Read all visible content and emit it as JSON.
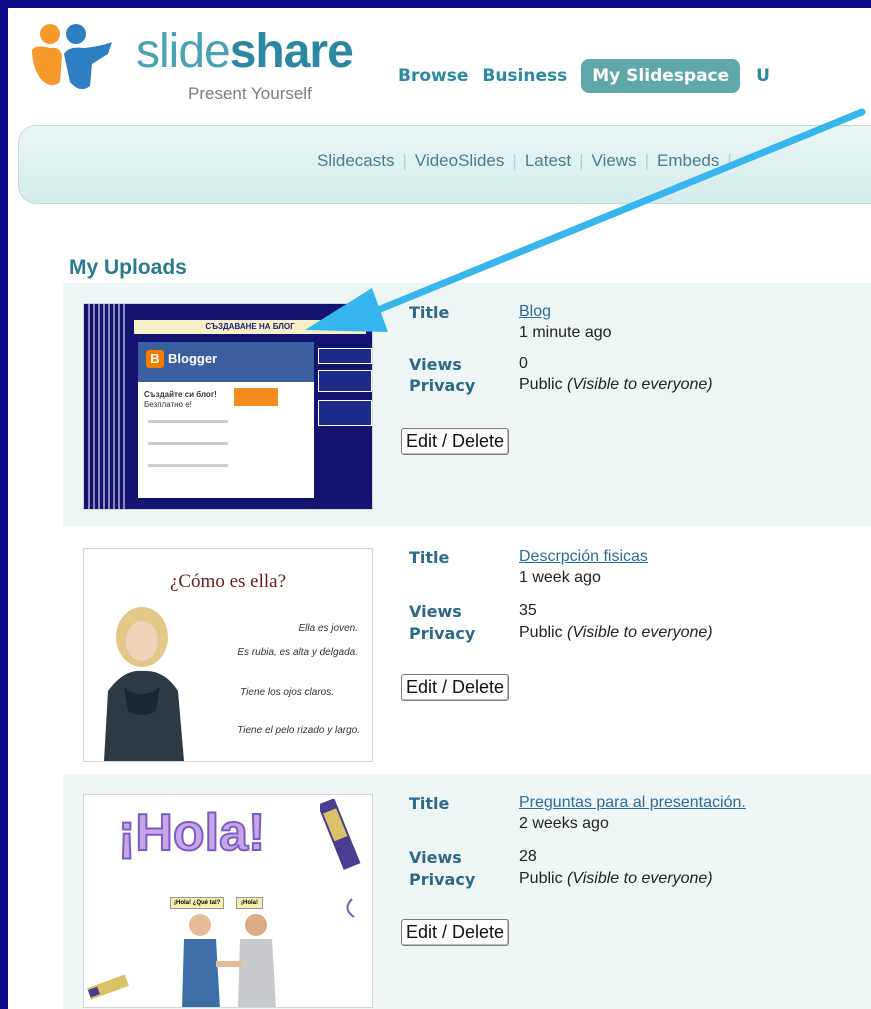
{
  "header": {
    "logo_slide": "slide",
    "logo_share": "share",
    "tagline": "Present Yourself",
    "nav": [
      "Browse",
      "Business",
      "My Slidespace",
      "U"
    ],
    "active_nav": "My Slidespace"
  },
  "subnav": [
    "Slidecasts",
    "VideoSlides",
    "Latest",
    "Views",
    "Embeds"
  ],
  "section_title": "My Uploads",
  "labels": {
    "title": "Title",
    "views": "Views",
    "privacy": "Privacy"
  },
  "uploads": [
    {
      "title": "Blog",
      "time": "1 minute ago",
      "views": "0",
      "privacy": "Public",
      "privacy_note": "(Visible to everyone)",
      "button": "Edit / Delete",
      "thumb": {
        "banner": "СЪЗДАВАНЕ НА БЛОГ",
        "brand": "Blogger",
        "heading": "Създайте си блог!",
        "subheading": "Безплатно е!"
      }
    },
    {
      "title": "Descrpción fisicas",
      "time": "1 week ago",
      "views": "35",
      "privacy": "Public",
      "privacy_note": "(Visible to everyone)",
      "button": "Edit / Delete",
      "thumb": {
        "heading": "¿Cómo es ella?",
        "lines": [
          "Ella es joven.",
          "Es rubia, es alta y delgada.",
          "Tiene los ojos claros.",
          "Tiene el pelo rizado y largo."
        ]
      }
    },
    {
      "title": "Preguntas para al presentación.",
      "time": "2 weeks ago",
      "views": "28",
      "privacy": "Public",
      "privacy_note": "(Visible to everyone)",
      "button": "Edit / Delete",
      "thumb": {
        "heading": "¡Hola!",
        "bubble1": "¡Hola! ¿Qué tal?",
        "bubble2": "¡Hola!"
      }
    }
  ],
  "colors": {
    "frame": "#0b0b8a",
    "accent": "#2c8aa0",
    "arrow": "#36b6ec"
  }
}
